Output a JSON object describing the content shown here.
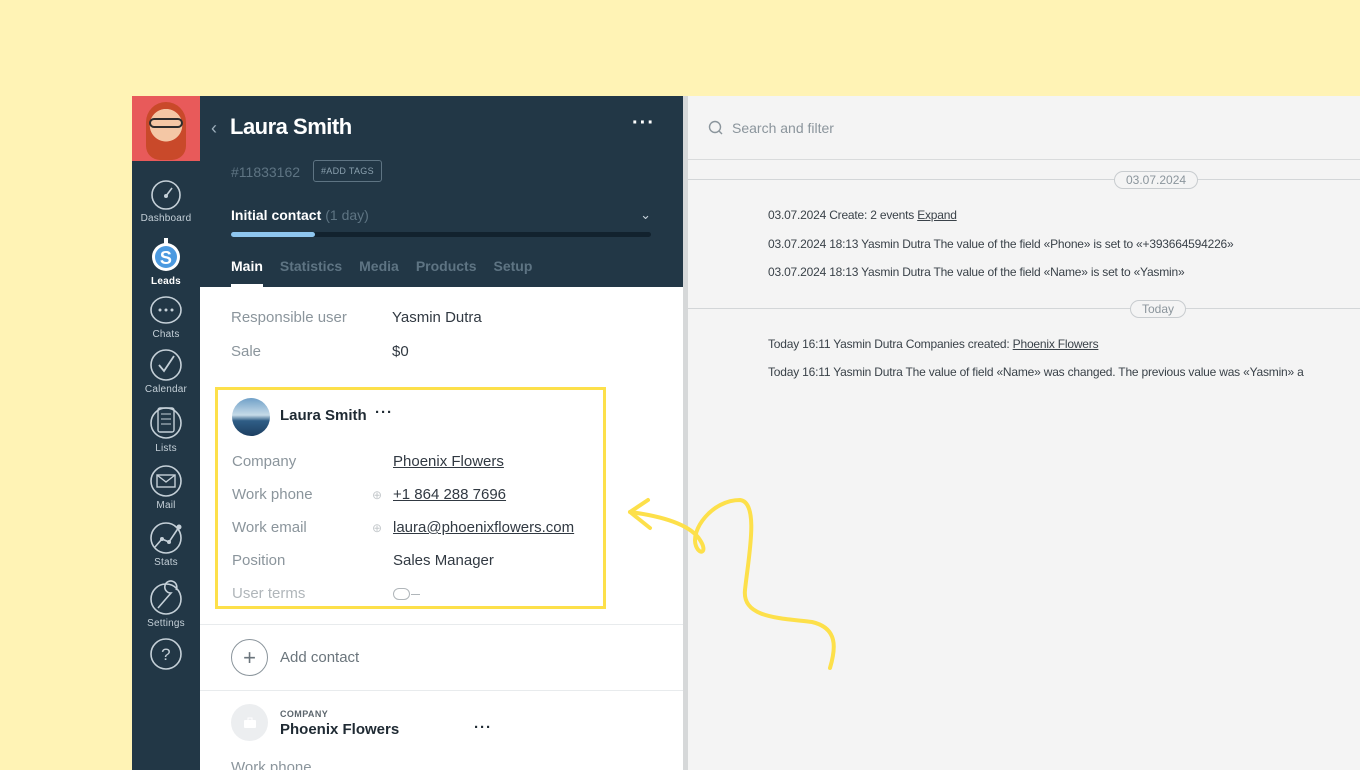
{
  "sidebar": {
    "items": [
      {
        "label": "Dashboard",
        "icon": "dashboard-icon"
      },
      {
        "label": "Leads",
        "icon": "leads-icon",
        "active": true
      },
      {
        "label": "Chats",
        "icon": "chats-icon"
      },
      {
        "label": "Calendar",
        "icon": "calendar-icon"
      },
      {
        "label": "Lists",
        "icon": "lists-icon"
      },
      {
        "label": "Mail",
        "icon": "mail-icon"
      },
      {
        "label": "Stats",
        "icon": "stats-icon"
      },
      {
        "label": "Settings",
        "icon": "settings-icon"
      }
    ]
  },
  "card": {
    "title": "Laura Smith",
    "more": "···",
    "id": "#11833162",
    "add_tags": "#ADD TAGS",
    "stage": "Initial contact",
    "stage_duration": "(1 day)",
    "stage_progress": 0.2,
    "tabs": [
      "Main",
      "Statistics",
      "Media",
      "Products",
      "Setup"
    ],
    "fields": {
      "responsible_label": "Responsible user",
      "responsible_value": "Yasmin Dutra",
      "sale_label": "Sale",
      "sale_value": "$0"
    },
    "contact": {
      "name": "Laura Smith",
      "more": "···",
      "company_label": "Company",
      "company_value": "Phoenix Flowers",
      "phone_label": "Work phone",
      "phone_value": "+1 864 288 7696",
      "email_label": "Work email",
      "email_value": "laura@phoenixflowers.com",
      "position_label": "Position",
      "position_value": "Sales Manager",
      "terms_label": "User terms"
    },
    "add_contact": "Add contact",
    "company": {
      "caption": "COMPANY",
      "name": "Phoenix Flowers",
      "more": "···",
      "phone_label": "Work phone"
    }
  },
  "feed": {
    "search_placeholder": "Search and filter",
    "groups": [
      {
        "date": "03.07.2024",
        "events": [
          {
            "text": "03.07.2024 Create: 2 events ",
            "link": "Expand"
          },
          {
            "text": "03.07.2024 18:13 Yasmin Dutra The value of the field «Phone» is set to «+393664594226»"
          },
          {
            "text": "03.07.2024 18:13 Yasmin Dutra The value of the field «Name» is set to «Yasmin»"
          }
        ]
      },
      {
        "date": "Today",
        "events": [
          {
            "text": "Today 16:11 Yasmin Dutra Companies created: ",
            "link": "Phoenix Flowers"
          },
          {
            "text": "Today 16:11 Yasmin Dutra The value of field «Name» was changed. The previous value was «Yasmin» a"
          }
        ]
      }
    ]
  },
  "colors": {
    "background": "#fff3b5",
    "sidebar": "#223746",
    "highlight": "#fde04a",
    "progress": "#8ec6ef"
  }
}
